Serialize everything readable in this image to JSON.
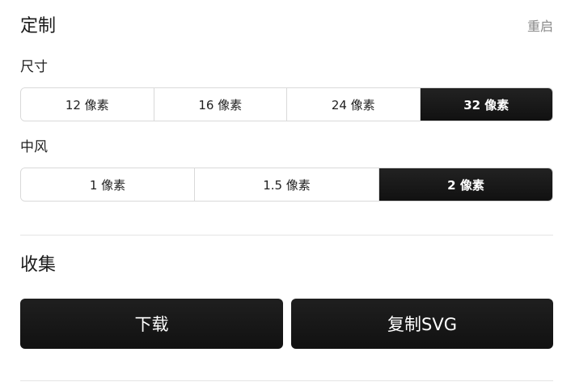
{
  "customize": {
    "title": "定制",
    "reset_label": "重启"
  },
  "size": {
    "label": "尺寸",
    "options": [
      "12 像素",
      "16 像素",
      "24 像素",
      "32 像素"
    ],
    "selected": "32 像素"
  },
  "stroke": {
    "label": "中风",
    "options": [
      "1 像素",
      "1.5 像素",
      "2 像素"
    ],
    "selected": "2 像素"
  },
  "collection": {
    "title": "收集",
    "download_label": "下载",
    "copy_svg_label": "复制SVG"
  }
}
